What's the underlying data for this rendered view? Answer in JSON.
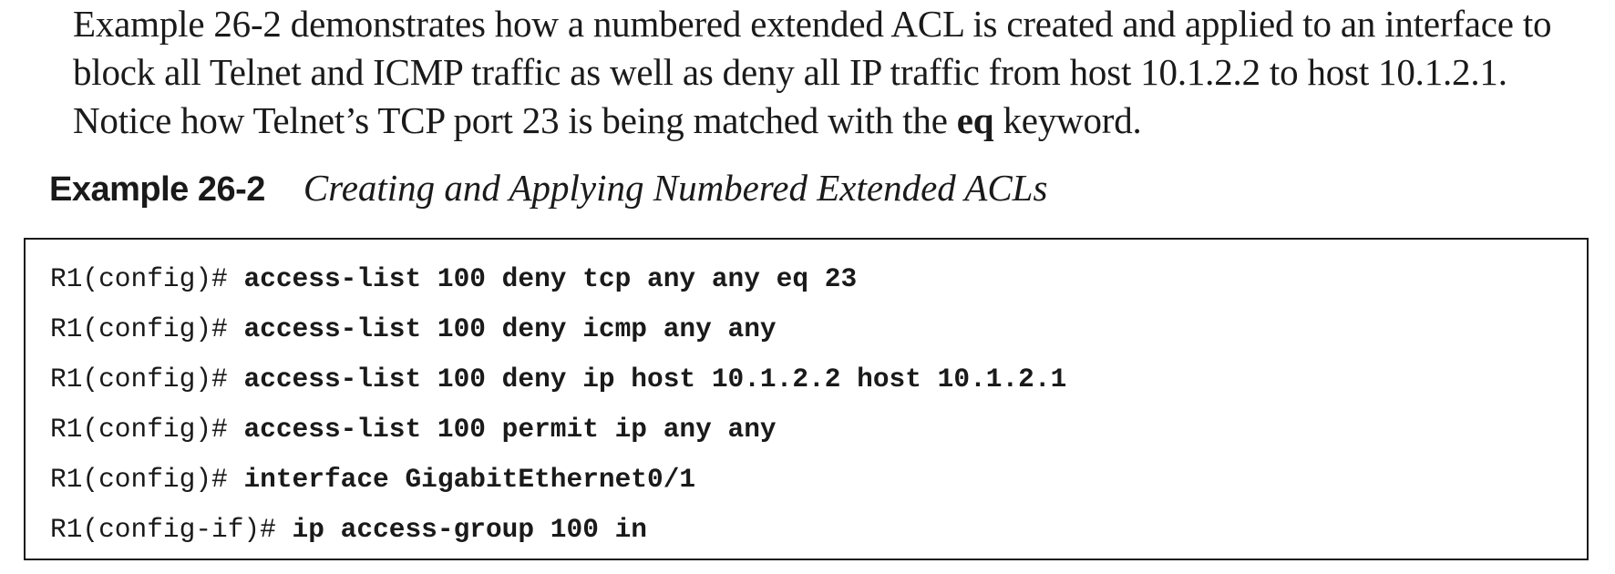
{
  "intro": {
    "part1": "Example 26-2 demonstrates how a numbered extended ACL is created and applied to an interface to block all Telnet and ICMP traffic as well as deny all IP traffic from host 10.1.2.2 to host 10.1.2.1. Notice how Telnet’s TCP port 23 is being matched with the ",
    "keyword": "eq",
    "part2": " keyword."
  },
  "caption": {
    "label": "Example 26-2",
    "title": "Creating and Applying Numbered Extended ACLs"
  },
  "code": {
    "lines": [
      {
        "prompt": "R1(config)# ",
        "command": "access-list 100 deny tcp any any eq 23"
      },
      {
        "prompt": "R1(config)# ",
        "command": "access-list 100 deny icmp any any"
      },
      {
        "prompt": "R1(config)# ",
        "command": "access-list 100 deny ip host 10.1.2.2 host 10.1.2.1"
      },
      {
        "prompt": "R1(config)# ",
        "command": "access-list 100 permit ip any any"
      },
      {
        "prompt": "R1(config)# ",
        "command": "interface GigabitEthernet0/1"
      },
      {
        "prompt": "R1(config-if)# ",
        "command": "ip access-group 100 in"
      }
    ]
  }
}
